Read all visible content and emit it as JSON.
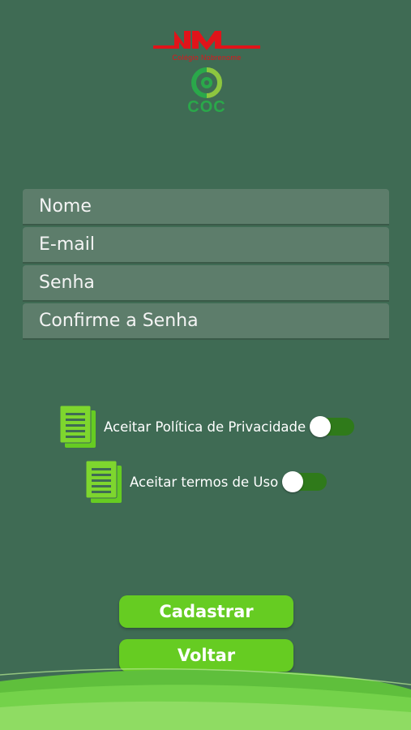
{
  "logo": {
    "brand_caption": "Colégio Nobrenome",
    "coc_text": "COC"
  },
  "form": {
    "name_placeholder": "Nome",
    "email_placeholder": "E-mail",
    "password_placeholder": "Senha",
    "confirm_password_placeholder": "Confirme a Senha"
  },
  "consents": {
    "privacy_label": "Aceitar Política de Privacidade",
    "privacy_accepted": false,
    "terms_label": "Aceitar termos de Uso",
    "terms_accepted": false,
    "icon": "document-icon"
  },
  "buttons": {
    "register_label": "Cadastrar",
    "back_label": "Voltar"
  },
  "colors": {
    "background": "#3f6b54",
    "field_background": "#5d7d6b",
    "accent_green": "#66cc22",
    "toggle_track": "#2f7a1a",
    "brand_red": "#e0141a",
    "coc_green": "#2aa84a"
  }
}
